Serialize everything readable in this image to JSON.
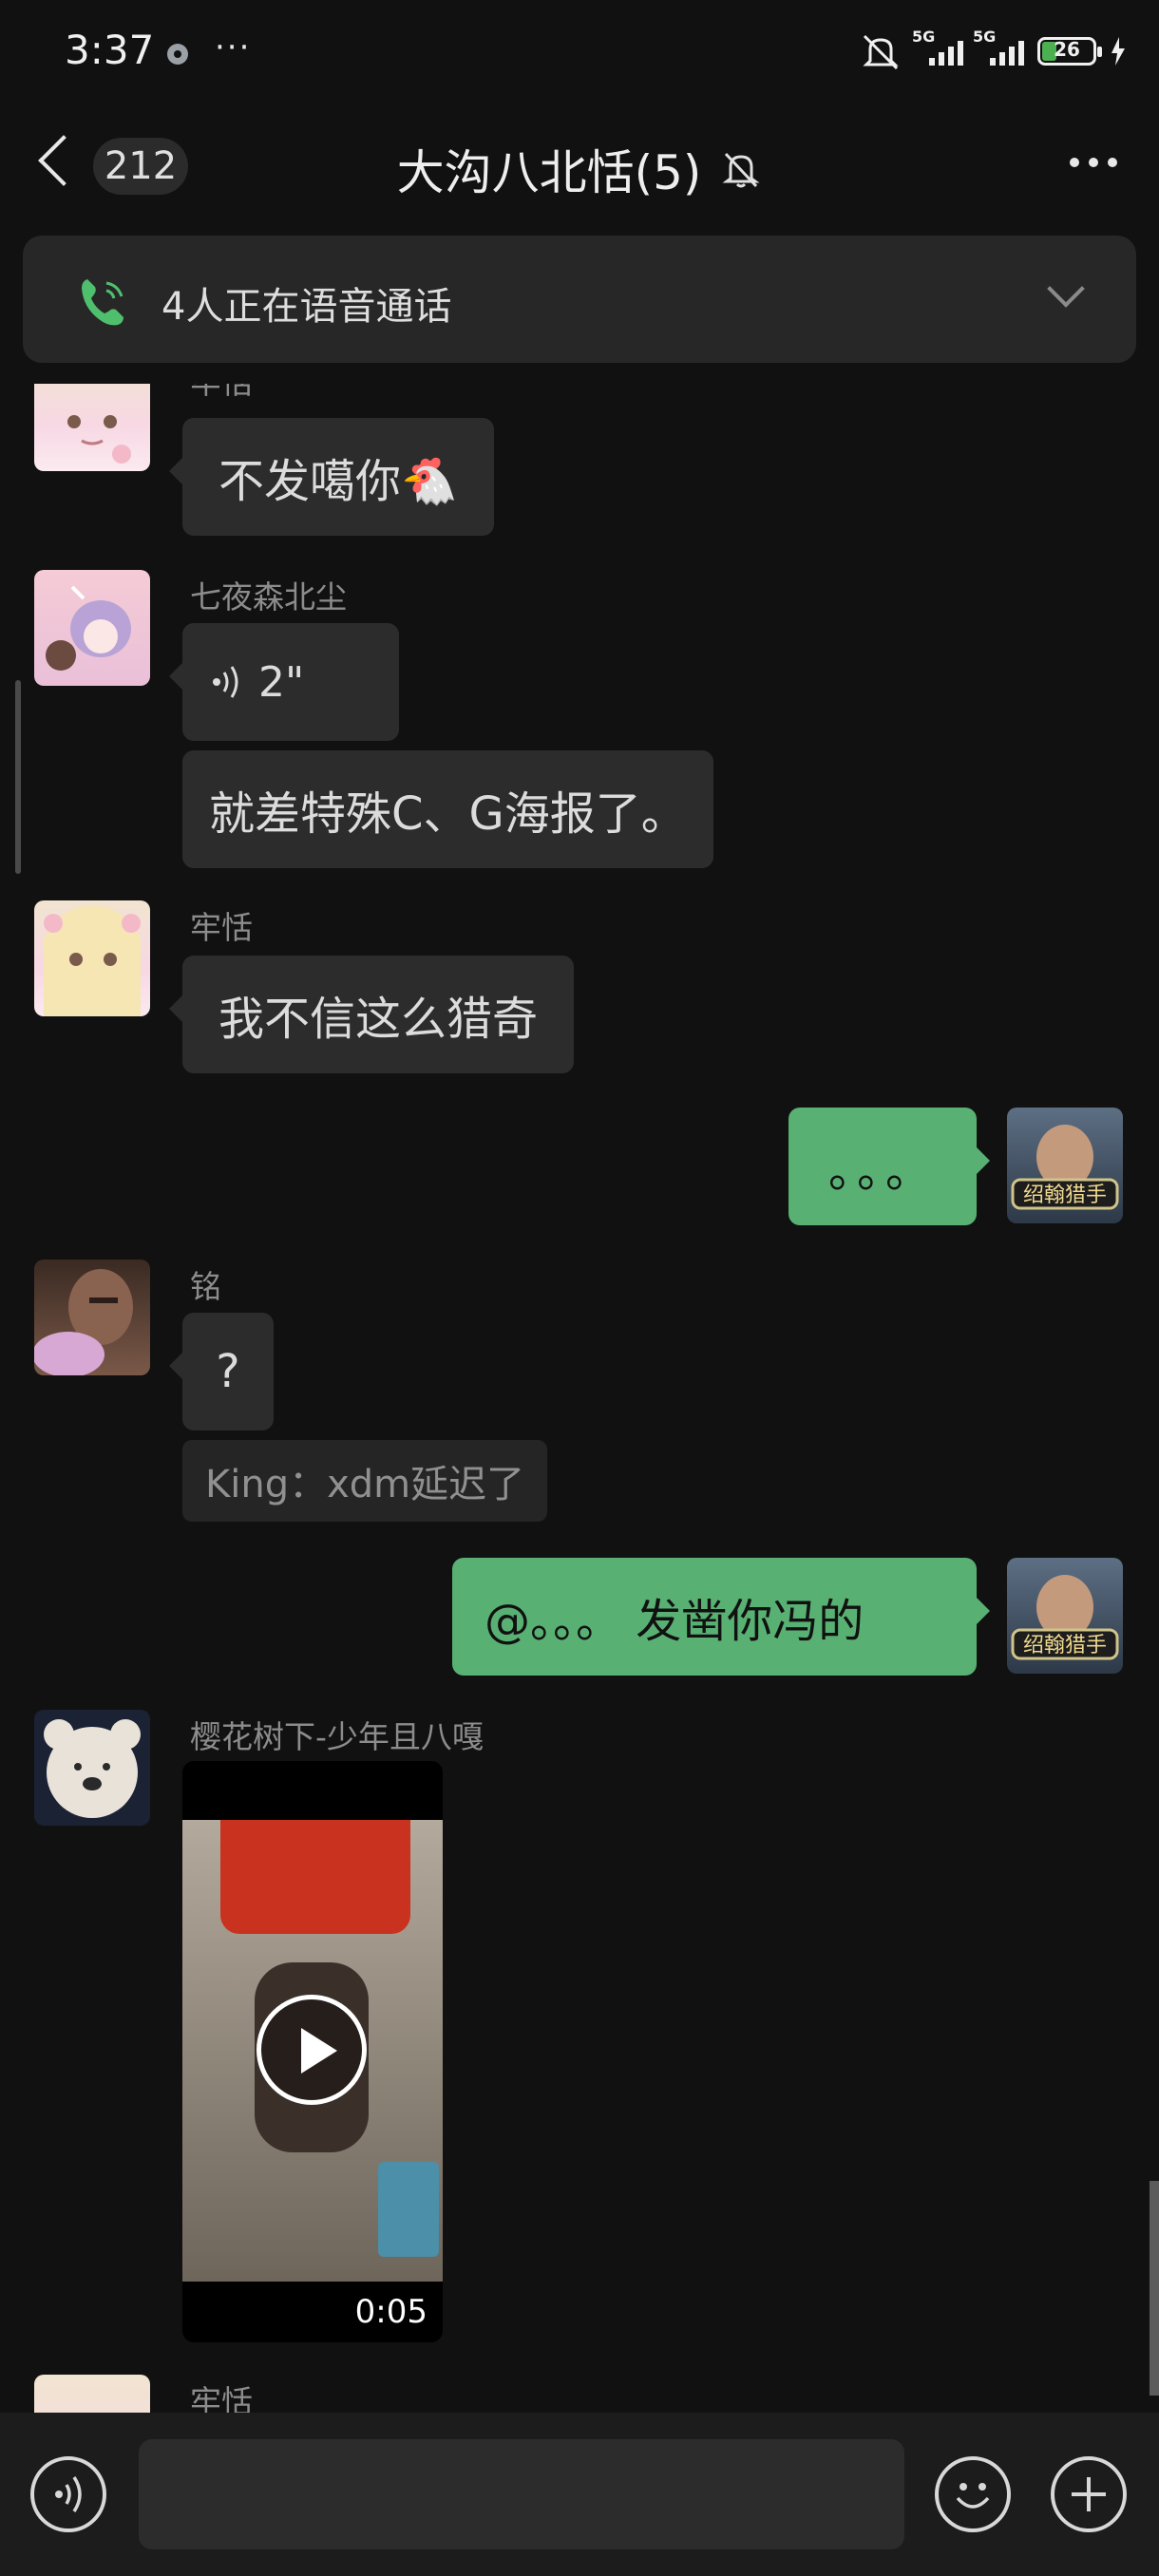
{
  "status_bar": {
    "time": "3:37",
    "more": "···",
    "net1": "5G",
    "net2": "5G",
    "battery": "26"
  },
  "header": {
    "unread_count": "212",
    "title": "大沟八北恬(5)"
  },
  "call_banner": {
    "text": "4人正在语音通话"
  },
  "colors": {
    "accent_green": "#58b173",
    "call_icon_green": "#4fbf6e",
    "background": "#111111"
  },
  "messages": [
    {
      "sender": "牢恬",
      "text": "不发噶你🐔"
    },
    {
      "sender": "七夜森北尘",
      "voice_duration": "2\"",
      "text": "就差特殊C、G海报了。"
    },
    {
      "sender": "牢恬",
      "text": "我不信这么猎奇"
    },
    {
      "sender": "me",
      "text": "。。。"
    },
    {
      "sender": "铭",
      "text": "?",
      "quote": "King：xdm延迟了"
    },
    {
      "sender": "me",
      "text": "@。。。 发凿你冯的"
    },
    {
      "sender": "樱花树下-少年且八嘎",
      "video_duration": "0:05"
    },
    {
      "sender": "牢恬"
    }
  ],
  "icons": [
    "back-icon",
    "bell-off-icon",
    "more-icon",
    "phone-icon",
    "chevron-down-icon",
    "voice-icon",
    "emoji-icon",
    "plus-icon",
    "play-icon"
  ]
}
